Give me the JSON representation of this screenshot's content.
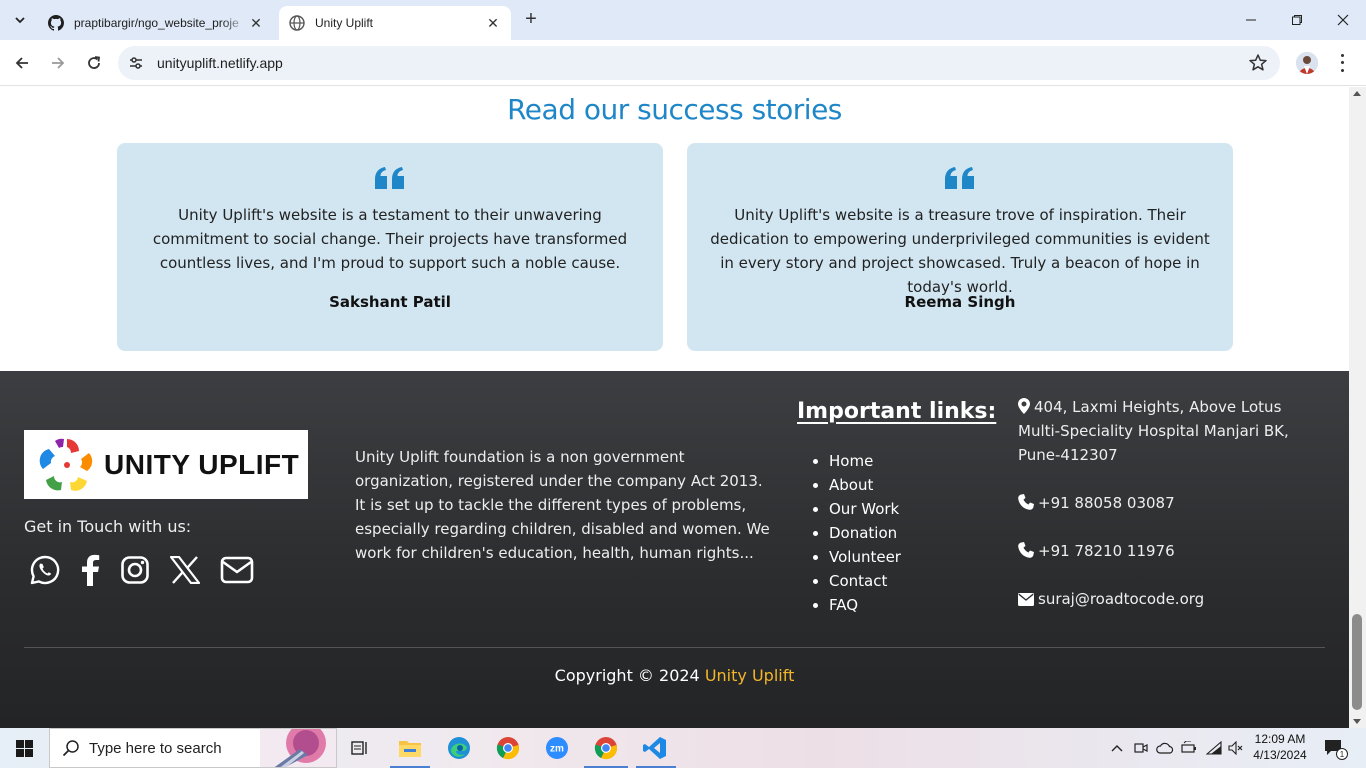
{
  "browser": {
    "tabs": [
      {
        "title": "praptibargir/ngo_website_proje",
        "favicon": "github-icon",
        "active": false
      },
      {
        "title": "Unity Uplift",
        "favicon": "globe-icon",
        "active": true
      }
    ],
    "url": "unityuplift.netlify.app"
  },
  "page": {
    "stories_title": "Read our success stories",
    "stories": [
      {
        "text": "Unity Uplift's website is a testament to their unwavering commitment to social change. Their projects have transformed countless lives, and I'm proud to support such a noble cause.",
        "author": "Sakshant Patil"
      },
      {
        "text": "Unity Uplift's website is a treasure trove of inspiration. Their dedication to empowering underprivileged communities is evident in every story and project showcased. Truly a beacon of hope in today's world.",
        "author": "Reema Singh"
      }
    ],
    "footer": {
      "logo_text": "UNITY UPLIFT",
      "get_in_touch": "Get in Touch with us:",
      "social_icons": [
        "whatsapp-icon",
        "facebook-icon",
        "instagram-icon",
        "x-icon",
        "envelope-icon"
      ],
      "about": "Unity Uplift foundation is a non government organization, registered under the company Act 2013. It is set up to tackle the different types of problems, especially regarding children, disabled and women. We work for children's education, health, human rights...",
      "links_title": "Important links:",
      "links": [
        "Home",
        "About",
        "Our Work",
        "Donation",
        "Volunteer",
        "Contact",
        "FAQ"
      ],
      "address": "404, Laxmi Heights, Above Lotus Multi-Speciality Hospital Manjari BK, Pune-412307",
      "phone_1": "+91 88058 03087",
      "phone_2": "+91 78210 11976",
      "email": "suraj@roadtocode.org",
      "copyright_prefix": "Copyright © 2024",
      "copyright_brand": "Unity Uplift"
    },
    "colors": {
      "accent_blue": "#1f87c8",
      "card_bg": "#d2e6f2",
      "brand_yellow": "#f3b52a",
      "footer_bg": "#2f3033"
    }
  },
  "taskbar": {
    "search_placeholder": "Type here to search",
    "apps": [
      "task-view-icon",
      "file-explorer-icon",
      "edge-icon",
      "chrome-icon",
      "zoom-icon",
      "chrome-active-icon",
      "vscode-icon"
    ],
    "zoom_label": "zm",
    "time": "12:09 AM",
    "date": "4/13/2024",
    "notification_count": "1"
  }
}
